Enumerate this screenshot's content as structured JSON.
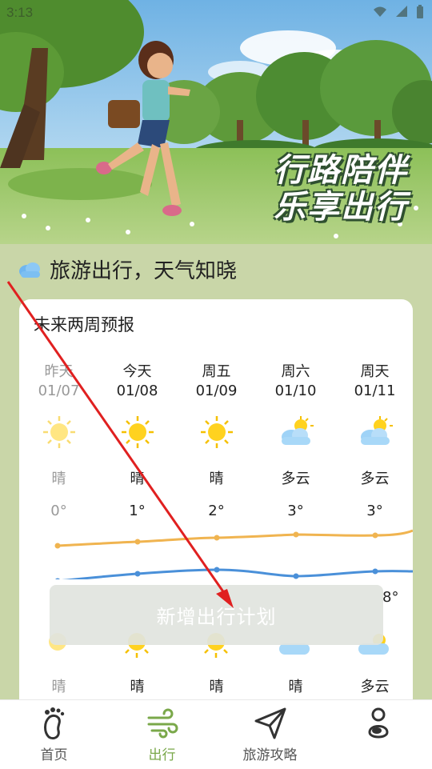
{
  "status_bar": {
    "time": "3:13"
  },
  "hero": {
    "slogan_line1": "行路陪伴",
    "slogan_line2": "乐享出行"
  },
  "section": {
    "title": "旅游出行，天气知晓"
  },
  "forecast": {
    "title": "未来两周预报",
    "days": [
      {
        "name": "昨天",
        "date": "01/07",
        "condition": "晴",
        "temp": "0°",
        "icon": "sunny-icon",
        "past": true
      },
      {
        "name": "今天",
        "date": "01/08",
        "condition": "晴",
        "temp": "1°",
        "icon": "sunny-icon"
      },
      {
        "name": "周五",
        "date": "01/09",
        "condition": "晴",
        "temp": "2°",
        "icon": "sunny-icon"
      },
      {
        "name": "周六",
        "date": "01/10",
        "condition": "多云",
        "temp": "3°",
        "icon": "partly-cloudy-icon"
      },
      {
        "name": "周天",
        "date": "01/11",
        "condition": "多云",
        "temp": "3°",
        "icon": "partly-cloudy-icon"
      }
    ],
    "night_conditions": [
      "晴",
      "晴",
      "晴",
      "晴",
      "多云"
    ],
    "night_temp_peek": "8°",
    "line_colors": {
      "high": "#f0b450",
      "low": "#4a90d9"
    }
  },
  "overlay": {
    "button_label": "新增出行计划"
  },
  "nav": {
    "items": [
      {
        "label": "首页",
        "icon": "footprint-icon"
      },
      {
        "label": "出行",
        "icon": "wind-icon",
        "active": true
      },
      {
        "label": "旅游攻略",
        "icon": "paper-plane-icon"
      },
      {
        "label": "",
        "icon": "profile-icon"
      }
    ],
    "active_color": "#7aa84a"
  }
}
